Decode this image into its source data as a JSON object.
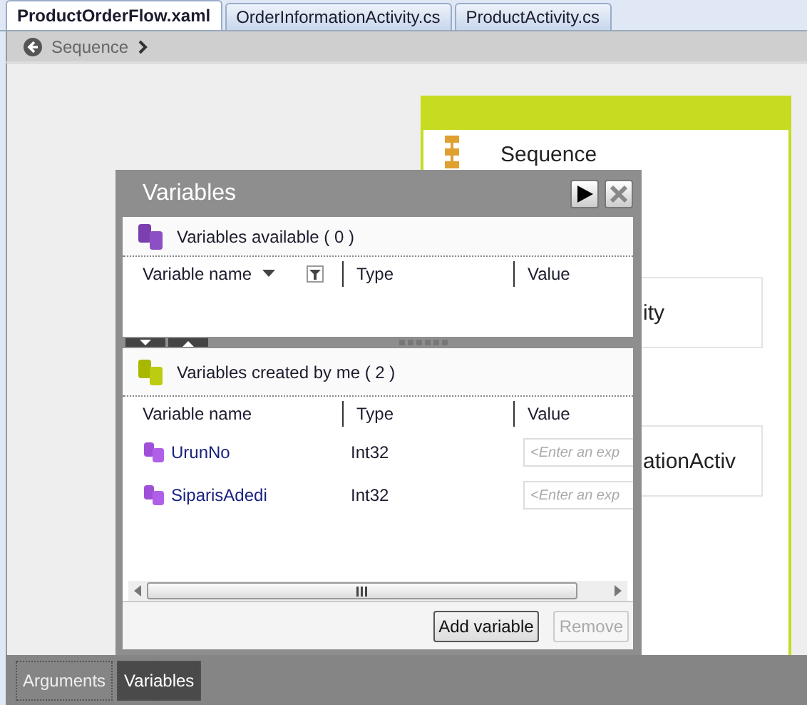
{
  "tabs": [
    {
      "label": "ProductOrderFlow.xaml",
      "selected": true
    },
    {
      "label": "OrderInformationActivity.cs",
      "selected": false
    },
    {
      "label": "ProductActivity.cs",
      "selected": false
    }
  ],
  "breadcrumb": {
    "label": "Sequence"
  },
  "sequence": {
    "title": "Sequence",
    "activities": [
      "ity",
      "ationActiv"
    ]
  },
  "variables_panel": {
    "title": "Variables",
    "available": {
      "heading": "Variables available ( 0 )",
      "columns": [
        "Variable name",
        "Type",
        "Value"
      ]
    },
    "created": {
      "heading": "Variables created by me ( 2 )",
      "columns": [
        "Variable name",
        "Type",
        "Value"
      ],
      "rows": [
        {
          "name": "UrunNo",
          "type": "Int32",
          "placeholder": "<Enter an exp"
        },
        {
          "name": "SiparisAdedi",
          "type": "Int32",
          "placeholder": "<Enter an exp"
        }
      ]
    },
    "buttons": [
      {
        "label": "Add variable",
        "disabled": false
      },
      {
        "label": "Remove",
        "disabled": true
      }
    ]
  },
  "bottom_tabs": [
    {
      "label": "Arguments",
      "selected": false
    },
    {
      "label": "Variables",
      "selected": true
    }
  ]
}
